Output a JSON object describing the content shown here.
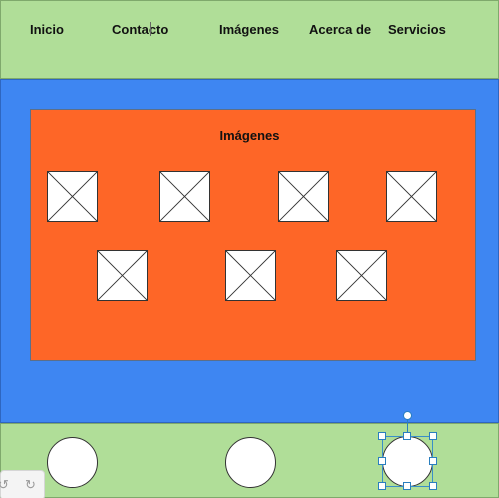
{
  "header": {
    "nav": [
      {
        "label": "Inicio"
      },
      {
        "label": "Contacto"
      },
      {
        "label": "Imágenes"
      },
      {
        "label": "Acerca de"
      },
      {
        "label": "Servicios"
      }
    ]
  },
  "gallery": {
    "title": "Imágenes",
    "image_placeholders": 7
  },
  "footer": {
    "circles": 3,
    "selected_circle_index": 2
  },
  "toolbar": {
    "undo_icon": "undo-icon",
    "redo_icon": "redo-icon"
  },
  "colors": {
    "header_footer": "#b0de98",
    "main_background": "#3e86f2",
    "gallery_background": "#fe6627",
    "selection": "#2a7fbf"
  }
}
